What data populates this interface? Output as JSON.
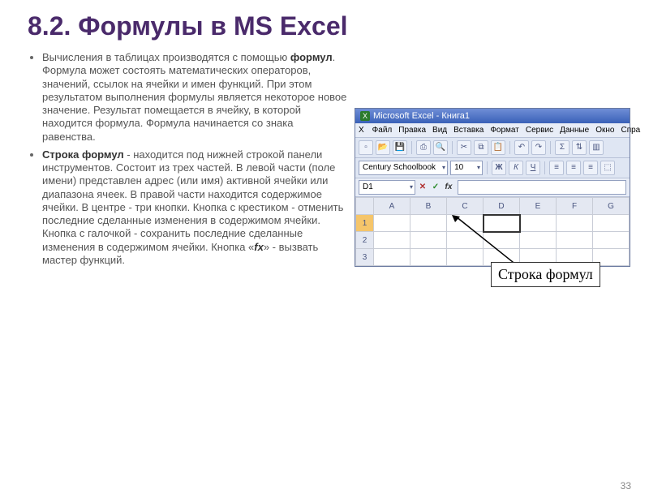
{
  "title": "8.2. Формулы в MS Excel",
  "bullets": [
    {
      "lead": "Вычисления в таблицах производятся с помощью ",
      "bold1": "формул",
      "rest": ". Формула может состоять математических операторов, значений, ссылок на ячейки и имен функций. При этом результатом выполнения формулы является некоторое новое значение. Результат помещается в ячейку, в которой находится формула. Формула начинается со знака равенства."
    },
    {
      "bold1": "Строка формул",
      "lead": " - находится под нижней строкой панели инструментов. Состоит из трех частей. В левой части (поле имени) представлен адрес (или имя) активной ячейки или диапазона ячеек. В правой части находится содержимое ячейки. В центре - три кнопки. Кнопка с крестиком - отменить последние сделанные изменения в содержимом ячейки. Кнопка с галочкой - сохранить последние сделанные изменения в содержимом ячейки. Кнопка «",
      "bold2": "fx",
      "rest": "» - вызвать мастер функций."
    }
  ],
  "excel": {
    "app_title": "Microsoft Excel - Книга1",
    "menu": [
      "Файл",
      "Правка",
      "Вид",
      "Вставка",
      "Формат",
      "Сервис",
      "Данные",
      "Окно",
      "Спра"
    ],
    "font": "Century Schoolbook",
    "fontsize": "10",
    "bold": "Ж",
    "italic": "К",
    "underline": "Ч",
    "namebox": "D1",
    "fb_cancel": "✕",
    "fb_ok": "✓",
    "fb_fx": "fx",
    "cols": [
      "",
      "A",
      "B",
      "C",
      "D",
      "E",
      "F",
      "G"
    ],
    "rows": [
      "1",
      "2",
      "3"
    ]
  },
  "callout": "Строка формул",
  "pagenum": "33"
}
